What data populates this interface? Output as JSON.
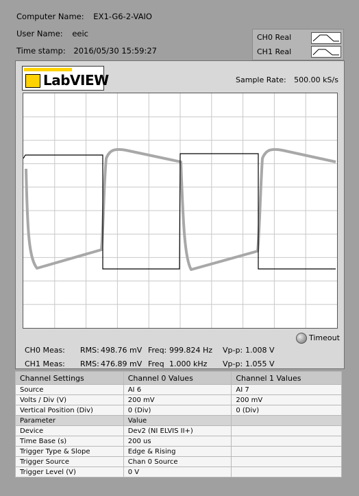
{
  "info": {
    "computer_label": "Computer Name:",
    "computer_value": "EX1-G6-2-VAIO",
    "user_label": "User Name:",
    "user_value": "eeic",
    "time_label": "Time stamp:",
    "time_value": "2016/05/30 15:59:27"
  },
  "legend": {
    "items": [
      {
        "label": "CH0 Real"
      },
      {
        "label": "CH1 Real"
      }
    ]
  },
  "logo": {
    "text": "LabVIEW"
  },
  "sample_rate": {
    "label": "Sample Rate:",
    "value": "500.00 kS/s"
  },
  "timeout": {
    "label": "Timeout"
  },
  "meas": {
    "ch0": {
      "label": "CH0 Meas:",
      "rms_label": "RMS:",
      "rms": "498.76 mV",
      "freq_label": "Freq:",
      "freq": "999.824 Hz",
      "vpp_label": "Vp-p:",
      "vpp": "1.008 V"
    },
    "ch1": {
      "label": "CH1 Meas:",
      "rms_label": "RMS:",
      "rms": "476.89 mV",
      "freq_label": "Freq",
      "freq": "1.000 kHz",
      "vpp_label": "Vp-p:",
      "vpp": "1.055 V"
    }
  },
  "table": {
    "headers": [
      "Channel Settings",
      "Channel 0 Values",
      "Channel 1 Values"
    ],
    "rows": [
      [
        "Source",
        "AI 6",
        "AI 7"
      ],
      [
        "Volts / Div (V)",
        "200 mV",
        "200 mV"
      ],
      [
        "Vertical Position (Div)",
        "0 (Div)",
        "0 (Div)"
      ],
      [
        "Parameter",
        "Value",
        ""
      ],
      [
        "Device",
        "Dev2 (NI ELVIS II+)",
        ""
      ],
      [
        "Time Base (s)",
        "200 us",
        ""
      ],
      [
        "Trigger Type & Slope",
        "Edge & Rising",
        ""
      ],
      [
        "Trigger Source",
        "Chan 0 Source",
        ""
      ],
      [
        "Trigger Level (V)",
        "0 V",
        ""
      ]
    ]
  },
  "colors": {
    "ch0_trace": "#000000",
    "ch1_trace": "#a8a8a8",
    "grid": "#c8c8c8"
  }
}
